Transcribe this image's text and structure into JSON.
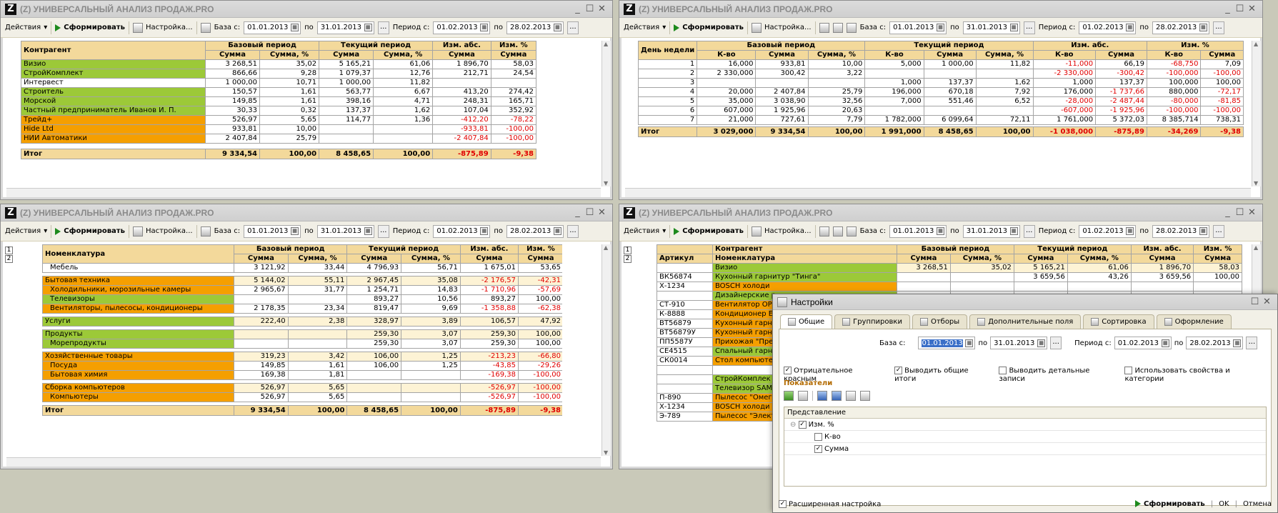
{
  "window_title": "(Z) УНИВЕРСАЛЬНЫЙ АНАЛИЗ ПРОДАЖ.PRO",
  "toolbar": {
    "actions": "Действия",
    "generate": "Сформировать",
    "settings": "Настройка...",
    "base_from": "База с:",
    "to": "по",
    "period_from": "Период с:",
    "base_start": "01.01.2013",
    "base_end": "31.01.2013",
    "period_start": "01.02.2013",
    "period_end": "28.02.2013",
    "dots": "..."
  },
  "headers": {
    "contragent": "Контрагент",
    "nomenclature": "Номенклатура",
    "article": "Артикул",
    "day": "День недели",
    "base": "Базовый период",
    "current": "Текущий период",
    "abs": "Изм. абс.",
    "pct": "Изм. %",
    "sum": "Сумма",
    "sum_pct": "Сумма, %",
    "qty": "К-во"
  },
  "w1": {
    "rows": [
      {
        "c": "g",
        "name": "Визио",
        "bs": "3 268,51",
        "bp": "35,02",
        "cs": "5 165,21",
        "cp": "61,06",
        "a": "1 896,70",
        "p": "58,03",
        "red": false
      },
      {
        "c": "g",
        "name": "СтройКомплект",
        "bs": "866,66",
        "bp": "9,28",
        "cs": "1 079,37",
        "cp": "12,76",
        "a": "212,71",
        "p": "24,54",
        "red": false
      },
      {
        "c": "w",
        "name": "Интервест",
        "bs": "1 000,00",
        "bp": "10,71",
        "cs": "1 000,00",
        "cp": "11,82",
        "a": "",
        "p": "",
        "red": false
      },
      {
        "c": "g",
        "name": "Строитель",
        "bs": "150,57",
        "bp": "1,61",
        "cs": "563,77",
        "cp": "6,67",
        "a": "413,20",
        "p": "274,42",
        "red": false
      },
      {
        "c": "g",
        "name": "Морской",
        "bs": "149,85",
        "bp": "1,61",
        "cs": "398,16",
        "cp": "4,71",
        "a": "248,31",
        "p": "165,71",
        "red": false
      },
      {
        "c": "g",
        "name": "Частный предприниматель Иванов И. П.",
        "bs": "30,33",
        "bp": "0,32",
        "cs": "137,37",
        "cp": "1,62",
        "a": "107,04",
        "p": "352,92",
        "red": false
      },
      {
        "c": "o",
        "name": "Трейд+",
        "bs": "526,97",
        "bp": "5,65",
        "cs": "114,77",
        "cp": "1,36",
        "a": "-412,20",
        "p": "-78,22",
        "red": true
      },
      {
        "c": "o",
        "name": "Hide Ltd",
        "bs": "933,81",
        "bp": "10,00",
        "cs": "",
        "cp": "",
        "a": "-933,81",
        "p": "-100,00",
        "red": true
      },
      {
        "c": "o",
        "name": "НИИ Автоматики",
        "bs": "2 407,84",
        "bp": "25,79",
        "cs": "",
        "cp": "",
        "a": "-2 407,84",
        "p": "-100,00",
        "red": true
      }
    ],
    "total": {
      "name": "Итог",
      "bs": "9 334,54",
      "bp": "100,00",
      "cs": "8 458,65",
      "cp": "100,00",
      "a": "-875,89",
      "p": "-9,38"
    }
  },
  "w2": {
    "rows": [
      [
        "1",
        "16,000",
        "933,81",
        "10,00",
        "5,000",
        "1 000,00",
        "11,82",
        "-11,000",
        "66,19",
        "-68,750",
        "7,09"
      ],
      [
        "2",
        "2 330,000",
        "300,42",
        "3,22",
        "",
        "",
        "",
        "-2 330,000",
        "-300,42",
        "-100,000",
        "-100,00"
      ],
      [
        "3",
        "",
        "",
        "",
        "1,000",
        "137,37",
        "1,62",
        "1,000",
        "137,37",
        "100,000",
        "100,00"
      ],
      [
        "4",
        "20,000",
        "2 407,84",
        "25,79",
        "196,000",
        "670,18",
        "7,92",
        "176,000",
        "-1 737,66",
        "880,000",
        "-72,17"
      ],
      [
        "5",
        "35,000",
        "3 038,90",
        "32,56",
        "7,000",
        "551,46",
        "6,52",
        "-28,000",
        "-2 487,44",
        "-80,000",
        "-81,85"
      ],
      [
        "6",
        "607,000",
        "1 925,96",
        "20,63",
        "",
        "",
        "",
        "-607,000",
        "-1 925,96",
        "-100,000",
        "-100,00"
      ],
      [
        "7",
        "21,000",
        "727,61",
        "7,79",
        "1 782,000",
        "6 099,64",
        "72,11",
        "1 761,000",
        "5 372,03",
        "8 385,714",
        "738,31"
      ]
    ],
    "total": [
      "Итог",
      "3 029,000",
      "9 334,54",
      "100,00",
      "1 991,000",
      "8 458,65",
      "100,00",
      "-1 038,000",
      "-875,89",
      "-34,269",
      "-9,38"
    ]
  },
  "w3": {
    "rows": [
      {
        "c": "w",
        "t": "Мебель",
        "bs": "3 121,92",
        "bp": "33,44",
        "cs": "4 796,93",
        "cp": "56,71",
        "a": "1 675,01",
        "p": "53,65",
        "ind": 1
      },
      {
        "c": "o",
        "t": "Бытовая техника",
        "bs": "5 144,02",
        "bp": "55,11",
        "cs": "2 967,45",
        "cp": "35,08",
        "a": "-2 176,57",
        "p": "-42,31",
        "ind": 0
      },
      {
        "c": "o",
        "t": "Холодильники, морозильные камеры",
        "bs": "2 965,67",
        "bp": "31,77",
        "cs": "1 254,71",
        "cp": "14,83",
        "a": "-1 710,96",
        "p": "-57,69",
        "ind": 1
      },
      {
        "c": "g",
        "t": "Телевизоры",
        "bs": "",
        "bp": "",
        "cs": "893,27",
        "cp": "10,56",
        "a": "893,27",
        "p": "100,00",
        "ind": 1
      },
      {
        "c": "o",
        "t": "Вентиляторы, пылесосы, кондиционеры",
        "bs": "2 178,35",
        "bp": "23,34",
        "cs": "819,47",
        "cp": "9,69",
        "a": "-1 358,88",
        "p": "-62,38",
        "ind": 1
      },
      {
        "c": "g",
        "t": "Услуги",
        "bs": "222,40",
        "bp": "2,38",
        "cs": "328,97",
        "cp": "3,89",
        "a": "106,57",
        "p": "47,92",
        "ind": 0
      },
      {
        "c": "g",
        "t": "Продукты",
        "bs": "",
        "bp": "",
        "cs": "259,30",
        "cp": "3,07",
        "a": "259,30",
        "p": "100,00",
        "ind": 0
      },
      {
        "c": "g",
        "t": "Морепродукты",
        "bs": "",
        "bp": "",
        "cs": "259,30",
        "cp": "3,07",
        "a": "259,30",
        "p": "100,00",
        "ind": 1
      },
      {
        "c": "o",
        "t": "Хозяйственные товары",
        "bs": "319,23",
        "bp": "3,42",
        "cs": "106,00",
        "cp": "1,25",
        "a": "-213,23",
        "p": "-66,80",
        "ind": 0
      },
      {
        "c": "o",
        "t": "Посуда",
        "bs": "149,85",
        "bp": "1,61",
        "cs": "106,00",
        "cp": "1,25",
        "a": "-43,85",
        "p": "-29,26",
        "ind": 1
      },
      {
        "c": "o",
        "t": "Бытовая химия",
        "bs": "169,38",
        "bp": "1,81",
        "cs": "",
        "cp": "",
        "a": "-169,38",
        "p": "-100,00",
        "ind": 1
      },
      {
        "c": "o",
        "t": "Сборка компьютеров",
        "bs": "526,97",
        "bp": "5,65",
        "cs": "",
        "cp": "",
        "a": "-526,97",
        "p": "-100,00",
        "ind": 0
      },
      {
        "c": "o",
        "t": "Компьютеры",
        "bs": "526,97",
        "bp": "5,65",
        "cs": "",
        "cp": "",
        "a": "-526,97",
        "p": "-100,00",
        "ind": 1
      }
    ],
    "total": {
      "t": "Итог",
      "bs": "9 334,54",
      "bp": "100,00",
      "cs": "8 458,65",
      "cp": "100,00",
      "a": "-875,89",
      "p": "-9,38"
    }
  },
  "w4": {
    "rows": [
      {
        "art": "",
        "n": "Визио",
        "c": "g",
        "bs": "3 268,51",
        "bp": "35,02",
        "cs": "5 165,21",
        "cp": "61,06",
        "a": "1 896,70",
        "p": "58,03"
      },
      {
        "art": "ВК56874",
        "n": "Кухонный гарнитур \"Тинга\"",
        "c": "g",
        "bs": "",
        "bp": "",
        "cs": "3 659,56",
        "cp": "43,26",
        "a": "3 659,56",
        "p": "100,00"
      },
      {
        "art": "Х-1234",
        "n": "BOSCH холоди",
        "c": "o",
        "bs": "",
        "bp": "",
        "cs": "",
        "cp": "",
        "a": "",
        "p": ""
      },
      {
        "art": "",
        "n": "Дизайнерские р",
        "c": "g",
        "bs": "",
        "bp": "",
        "cs": "",
        "cp": "",
        "a": "",
        "p": ""
      },
      {
        "art": "СТ-910",
        "n": "Вентилятор ОРЕ",
        "c": "o",
        "bs": "",
        "bp": "",
        "cs": "",
        "cp": "",
        "a": "",
        "p": ""
      },
      {
        "art": "К-8888",
        "n": "Кондиционер EL",
        "c": "o",
        "bs": "",
        "bp": "",
        "cs": "",
        "cp": "",
        "a": "",
        "p": ""
      },
      {
        "art": "ВТ56879",
        "n": "Кухонный гарни",
        "c": "o",
        "bs": "",
        "bp": "",
        "cs": "",
        "cp": "",
        "a": "",
        "p": ""
      },
      {
        "art": "ВТ56879У",
        "n": "Кухонный гарни",
        "c": "o",
        "bs": "",
        "bp": "",
        "cs": "",
        "cp": "",
        "a": "",
        "p": ""
      },
      {
        "art": "ПП5587У",
        "n": "Прихожая \"Прес",
        "c": "o",
        "bs": "",
        "bp": "",
        "cs": "",
        "cp": "",
        "a": "",
        "p": ""
      },
      {
        "art": "СЕ4515",
        "n": "Спальный гарни",
        "c": "g",
        "bs": "",
        "bp": "",
        "cs": "",
        "cp": "",
        "a": "",
        "p": ""
      },
      {
        "art": "СК0014",
        "n": "Стол компьютер",
        "c": "o",
        "bs": "",
        "bp": "",
        "cs": "",
        "cp": "",
        "a": "",
        "p": ""
      },
      {
        "art": "",
        "n": "",
        "c": "w",
        "bs": "",
        "bp": "",
        "cs": "",
        "cp": "",
        "a": "",
        "p": ""
      },
      {
        "art": "",
        "n": "СтройКомплек",
        "c": "g",
        "bs": "",
        "bp": "",
        "cs": "",
        "cp": "",
        "a": "",
        "p": ""
      },
      {
        "art": "",
        "n": "Телевизор SAMS",
        "c": "g",
        "bs": "",
        "bp": "",
        "cs": "",
        "cp": "",
        "a": "",
        "p": ""
      },
      {
        "art": "П-890",
        "n": "Пылесос \"Омега",
        "c": "o",
        "bs": "",
        "bp": "",
        "cs": "",
        "cp": "",
        "a": "",
        "p": ""
      },
      {
        "art": "Х-1234",
        "n": "BOSCH холоди",
        "c": "o",
        "bs": "",
        "bp": "",
        "cs": "",
        "cp": "",
        "a": "",
        "p": ""
      },
      {
        "art": "Э-789",
        "n": "Пылесос \"Элект",
        "c": "o",
        "bs": "",
        "bp": "",
        "cs": "",
        "cp": "",
        "a": "",
        "p": ""
      }
    ]
  },
  "dialog": {
    "title": "Настройки",
    "tabs": [
      "Общие",
      "Группировки",
      "Отборы",
      "Дополнительные поля",
      "Сортировка",
      "Оформление"
    ],
    "negative_red": "Отрицательное красным",
    "show_totals": "Выводить общие итоги",
    "show_details": "Выводить детальные записи",
    "use_props": "Использовать свойства и категории",
    "indicators": "Показатели",
    "presentation": "Представление",
    "tree": [
      "Изм. %",
      "К-во",
      "Сумма"
    ],
    "extended": "Расширенная настройка",
    "ok": "OK",
    "cancel": "Отмена"
  }
}
